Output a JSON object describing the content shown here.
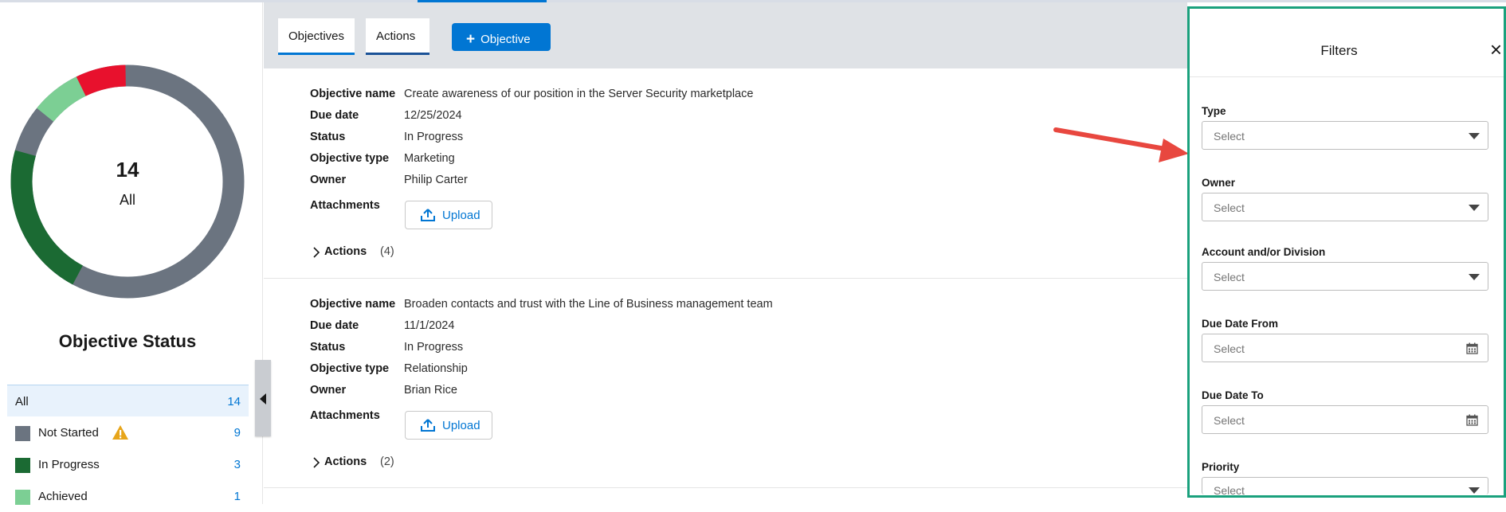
{
  "status_panel": {
    "total": "14",
    "total_label": "All",
    "title": "Objective Status",
    "items": [
      {
        "label": "All",
        "count": "14",
        "color": "",
        "warning": false
      },
      {
        "label": "Not Started",
        "count": "9",
        "color": "#6b7480",
        "warning": true
      },
      {
        "label": "In Progress",
        "count": "3",
        "color": "#1b6a33",
        "warning": false
      },
      {
        "label": "Achieved",
        "count": "1",
        "color": "#7ccf94",
        "warning": false
      }
    ],
    "donut_colors": {
      "not_started": "#6b7480",
      "in_progress": "#1b6a33",
      "achieved": "#7ccf94",
      "not_achieved": "#e8112d"
    }
  },
  "header": {
    "tabs": [
      "Objectives",
      "Actions"
    ],
    "add_button": "Objective",
    "accent": "#0176d3"
  },
  "objectives": [
    {
      "labels": {
        "name": "Objective name",
        "due": "Due date",
        "status": "Status",
        "type": "Objective type",
        "owner": "Owner",
        "attachments": "Attachments"
      },
      "name": "Create awareness of our position in the Server Security marketplace",
      "due": "12/25/2024",
      "status": "In Progress",
      "type": "Marketing",
      "owner": "Philip Carter",
      "upload_label": "Upload",
      "actions_label": "Actions",
      "actions_count": "(4)"
    },
    {
      "labels": {
        "name": "Objective name",
        "due": "Due date",
        "status": "Status",
        "type": "Objective type",
        "owner": "Owner",
        "attachments": "Attachments"
      },
      "name": "Broaden contacts and trust with the Line of Business management team",
      "due": "11/1/2024",
      "status": "In Progress",
      "type": "Relationship",
      "owner": "Brian Rice",
      "upload_label": "Upload",
      "actions_label": "Actions",
      "actions_count": "(2)"
    }
  ],
  "filters": {
    "title": "Filters",
    "close": "×",
    "fields": [
      {
        "label": "Type",
        "placeholder": "Select",
        "kind": "dropdown"
      },
      {
        "label": "Owner",
        "placeholder": "Select",
        "kind": "dropdown"
      },
      {
        "label": "Account and/or Division",
        "placeholder": "Select",
        "kind": "dropdown"
      },
      {
        "label": "Due Date From",
        "placeholder": "Select",
        "kind": "date"
      },
      {
        "label": "Due Date To",
        "placeholder": "Select",
        "kind": "date"
      },
      {
        "label": "Priority",
        "placeholder": "Select",
        "kind": "dropdown"
      }
    ],
    "border_color": "#1aa17d"
  },
  "annotation": {
    "arrow_color": "#e8473f"
  }
}
